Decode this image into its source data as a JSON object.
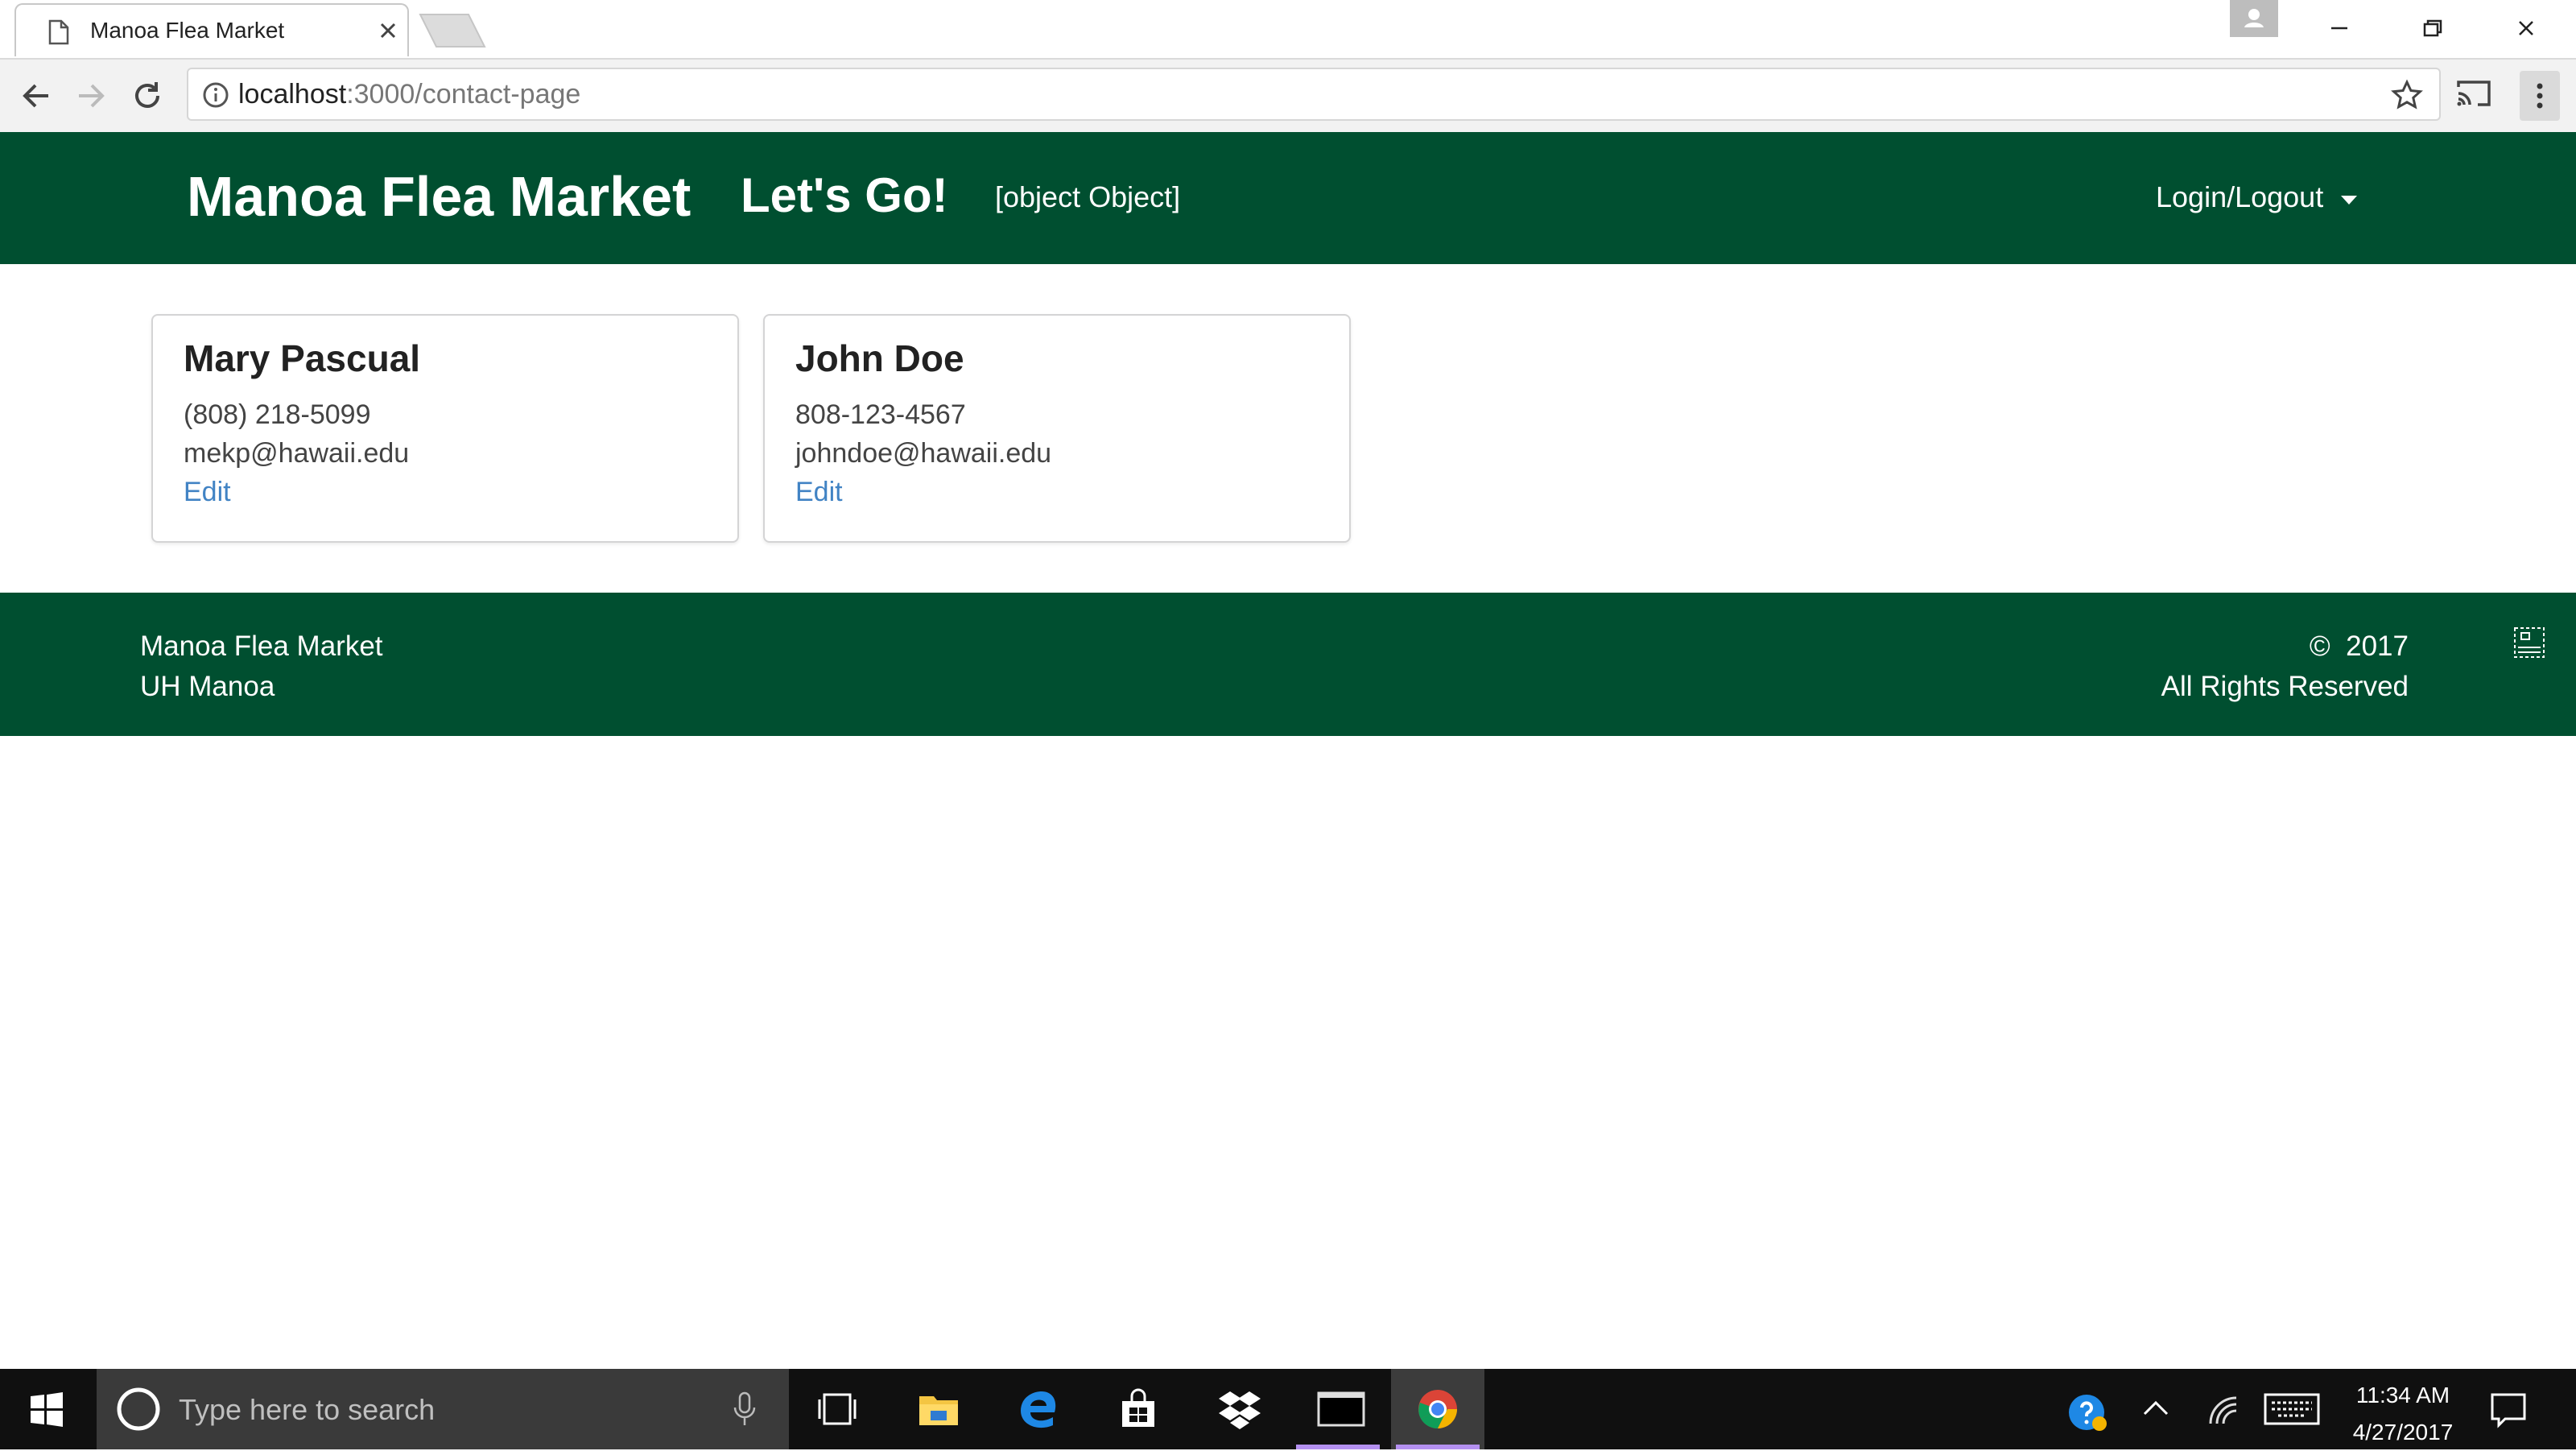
{
  "browser": {
    "tab_title": "Manoa Flea Market",
    "url_host": "localhost",
    "url_path": ":3000/contact-page"
  },
  "navbar": {
    "brand": "Manoa Flea Market",
    "lets_go": "Let's Go!",
    "object_link": "[object Object]",
    "login_menu": "Login/Logout"
  },
  "contacts": [
    {
      "name": "Mary Pascual",
      "phone": "(808) 218-5099",
      "email": "mekp@hawaii.edu",
      "action": "Edit"
    },
    {
      "name": "John Doe",
      "phone": "808-123-4567",
      "email": "johndoe@hawaii.edu",
      "action": "Edit"
    }
  ],
  "footer": {
    "line1": "Manoa Flea Market",
    "line2": "UH Manoa",
    "copyright_symbol": "©",
    "year": "2017",
    "rights": "All Rights Reserved"
  },
  "taskbar": {
    "search_placeholder": "Type here to search",
    "time": "11:34 AM",
    "date": "4/27/2017"
  },
  "colors": {
    "brand_green": "#004f30",
    "link_blue": "#4183c4"
  }
}
